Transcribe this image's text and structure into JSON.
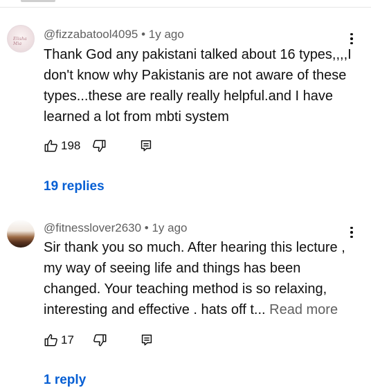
{
  "comments": [
    {
      "handle": "@fizzabatool4095",
      "time": "1y ago",
      "avatar_text": "Elisha Mia",
      "text": "Thank God any pakistani talked about 16 types,,,,I don't know why Pakistanis are not aware of these types...these are really really helpful.and I have learned a lot from mbti system",
      "likes": "198",
      "replies": "19 replies"
    },
    {
      "handle": "@fitnesslover2630",
      "time": "1y ago",
      "text": "Sir thank you so much. After hearing this lecture , my way of seeing life and things has been changed. Your teaching method is so relaxing, interesting and effective . hats off t...",
      "read_more": "Read more",
      "likes": "17",
      "replies": "1 reply"
    }
  ],
  "separator": " • ",
  "icons": {
    "avatar": "profile-picture",
    "more": "vertical-ellipsis-icon",
    "like": "thumbs-up-icon",
    "dislike": "thumbs-down-icon",
    "reply": "reply-comment-icon"
  },
  "colors": {
    "link_blue": "#065fd4",
    "meta_gray": "#606060",
    "text": "#0f0f0f"
  }
}
